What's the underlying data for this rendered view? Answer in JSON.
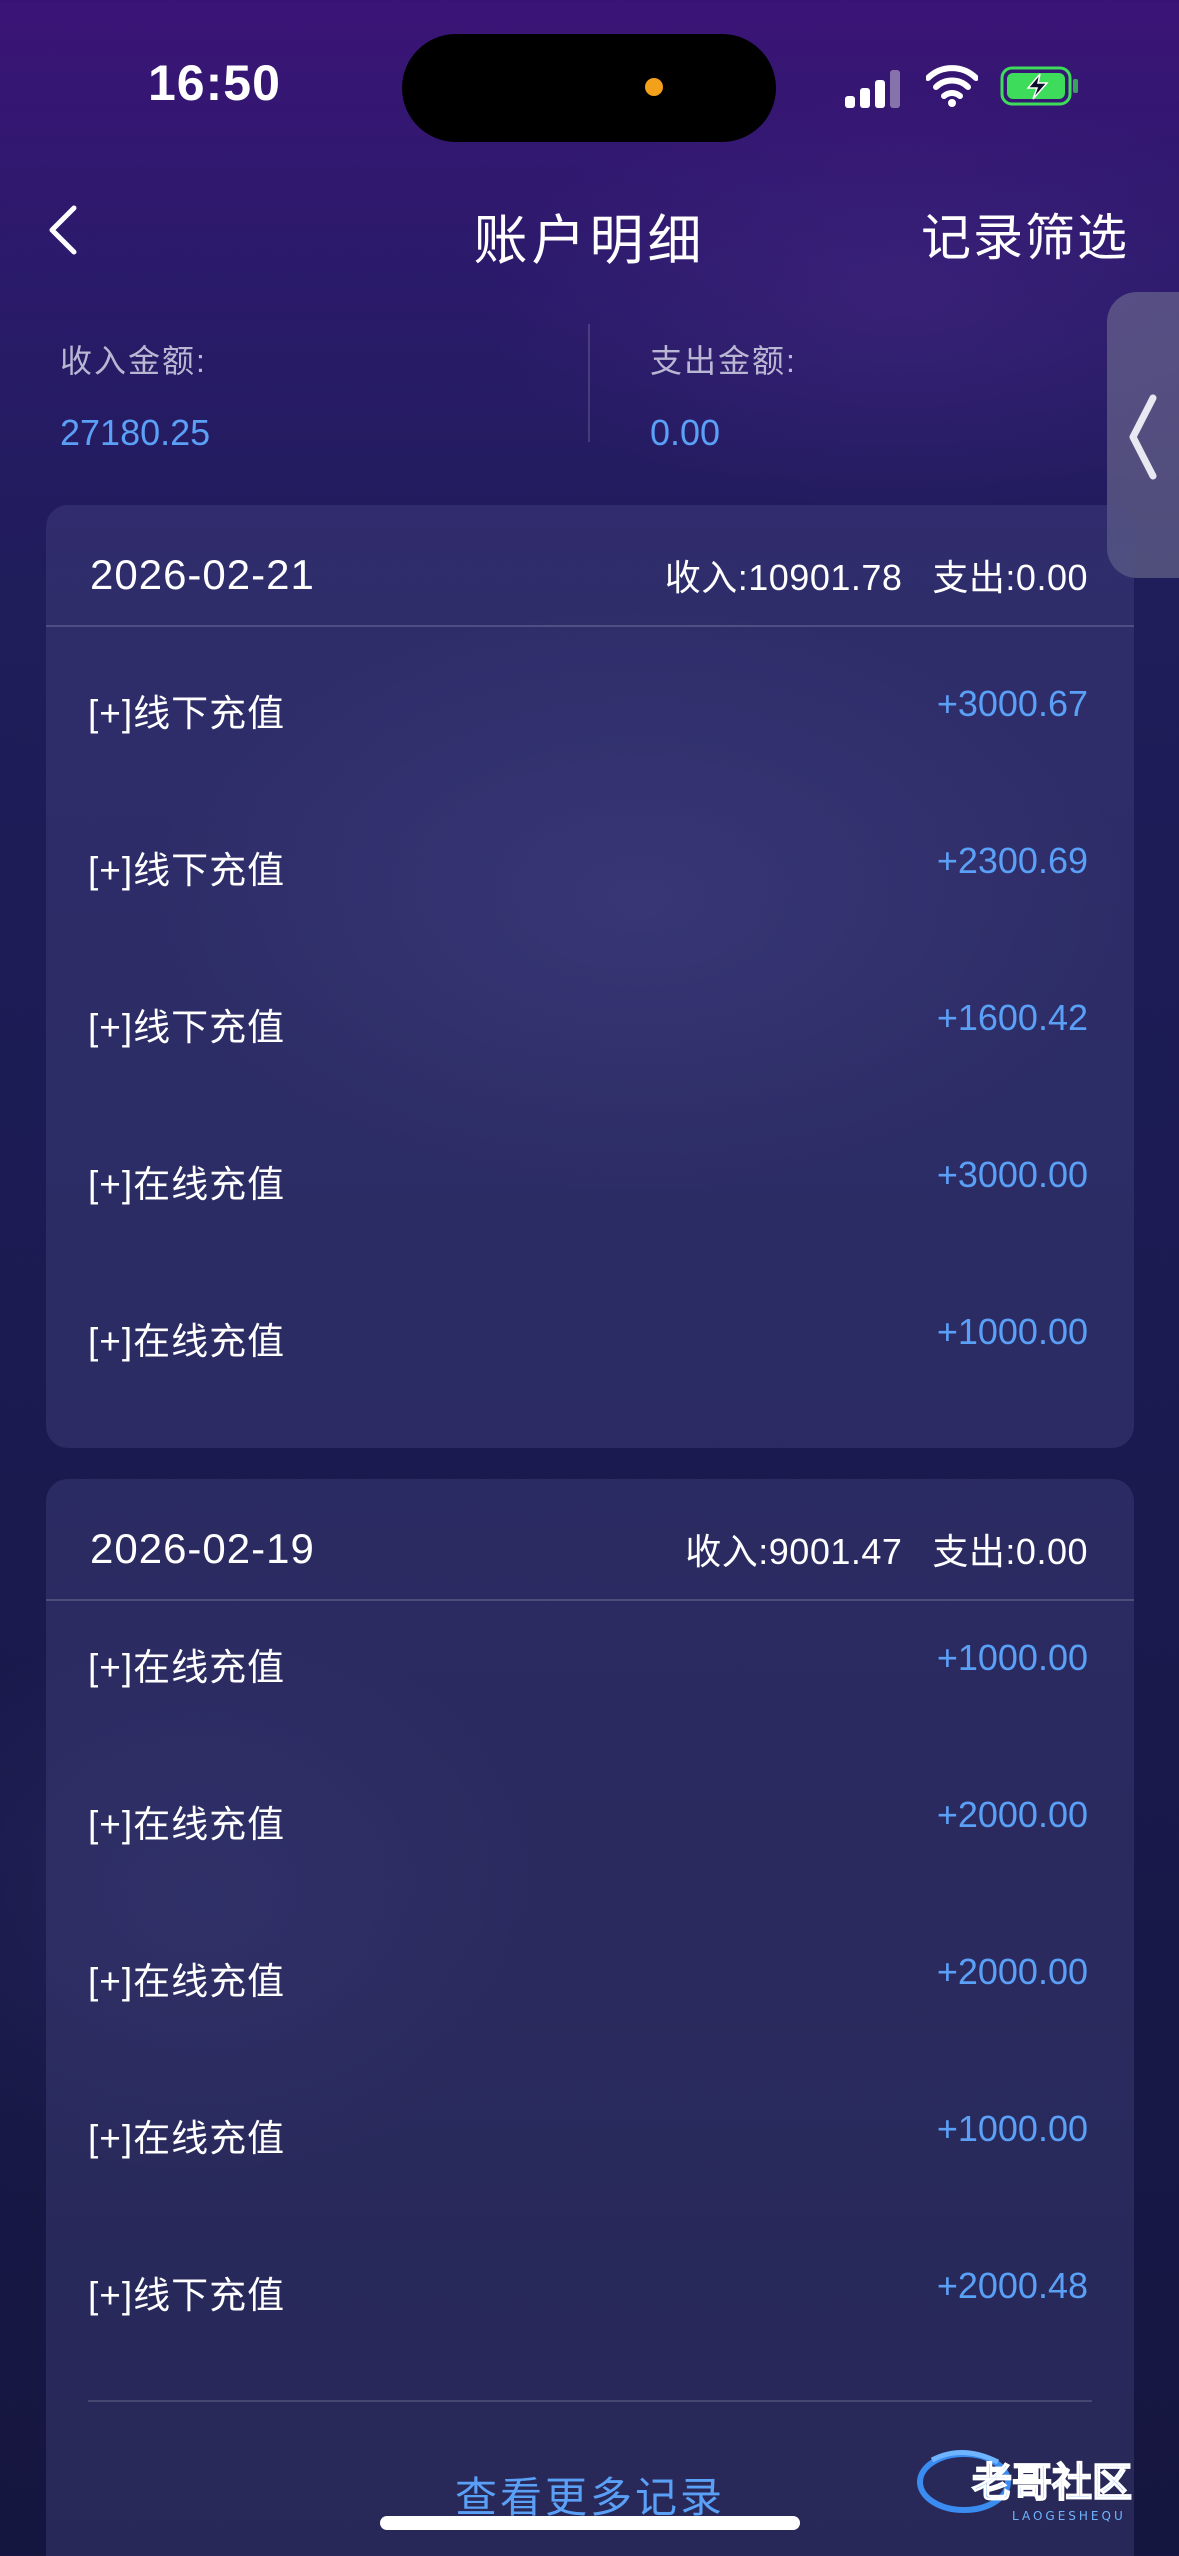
{
  "status_bar": {
    "time": "16:50"
  },
  "nav": {
    "title": "账户明细",
    "filter_label": "记录筛选"
  },
  "summary": {
    "income_label": "收入金额:",
    "income_value": "27180.25",
    "expense_label": "支出金额:",
    "expense_value": "0.00"
  },
  "days": [
    {
      "date": "2026-02-21",
      "income": "收入:10901.78",
      "expense": "支出:0.00",
      "items": [
        {
          "label": "[+]线下充值",
          "amount": "+3000.67"
        },
        {
          "label": "[+]线下充值",
          "amount": "+2300.69"
        },
        {
          "label": "[+]线下充值",
          "amount": "+1600.42"
        },
        {
          "label": "[+]在线充值",
          "amount": "+3000.00"
        },
        {
          "label": "[+]在线充值",
          "amount": "+1000.00"
        }
      ]
    },
    {
      "date": "2026-02-19",
      "income": "收入:9001.47",
      "expense": "支出:0.00",
      "items": [
        {
          "label": "[+]在线充值",
          "amount": "+1000.00"
        },
        {
          "label": "[+]在线充值",
          "amount": "+2000.00"
        },
        {
          "label": "[+]在线充值",
          "amount": "+2000.00"
        },
        {
          "label": "[+]在线充值",
          "amount": "+1000.00"
        },
        {
          "label": "[+]线下充值",
          "amount": "+2000.48"
        }
      ]
    }
  ],
  "more_label": "查看更多记录",
  "watermark": {
    "text": "老哥社区",
    "subtext": "LAOGESHEQU"
  },
  "colors": {
    "accent": "#5aa0f7",
    "battery": "#3ddc5a",
    "island_dot": "#f3a01a"
  },
  "icons": [
    "back-chevron-icon",
    "signal-icon",
    "wifi-icon",
    "battery-charging-icon",
    "side-handle-chevron-icon"
  ]
}
